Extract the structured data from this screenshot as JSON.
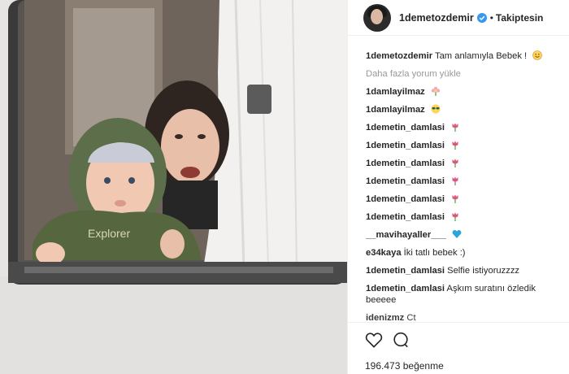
{
  "header": {
    "username": "1demetozdemir",
    "follow_label": "Takiptesin",
    "separator": "•"
  },
  "caption": {
    "username": "1demetozdemir",
    "text": "Tam anlamıyla Bebek !"
  },
  "load_more": "Daha fazla yorum yükle",
  "comments": [
    {
      "user": "1damlayilmaz",
      "text": "",
      "emoji": "flower"
    },
    {
      "user": "1damlayilmaz",
      "text": "",
      "emoji": "glasses"
    },
    {
      "user": "1demetin_damlasi",
      "text": "",
      "emoji": "tulip"
    },
    {
      "user": "1demetin_damlasi",
      "text": "",
      "emoji": "tulip"
    },
    {
      "user": "1demetin_damlasi",
      "text": "",
      "emoji": "tulip"
    },
    {
      "user": "1demetin_damlasi",
      "text": "",
      "emoji": "tulip"
    },
    {
      "user": "1demetin_damlasi",
      "text": "",
      "emoji": "tulip"
    },
    {
      "user": "1demetin_damlasi",
      "text": "",
      "emoji": "tulip"
    },
    {
      "user": "__mavihayaller___",
      "text": "",
      "emoji": "blue-heart"
    },
    {
      "user": "e34kaya",
      "text": "İki tatlı bebek :)",
      "emoji": ""
    },
    {
      "user": "1demetin_damlasi",
      "text": "Selfie istiyoruzzzz",
      "emoji": ""
    },
    {
      "user": "1demetin_damlasi",
      "text": "Aşkım suratını özledik beeeee",
      "emoji": ""
    },
    {
      "user": "idenizmz",
      "text": "Ct",
      "emoji": ""
    }
  ],
  "footer": {
    "likes_count": "196.473",
    "likes_label": "beğenme"
  },
  "colors": {
    "verified": "#3897f0",
    "tulip": "#e0567d",
    "heart_blue": "#2aa7d9",
    "muted": "#999999"
  },
  "icons": [
    "verified-badge-icon",
    "heart-icon",
    "comment-icon"
  ]
}
